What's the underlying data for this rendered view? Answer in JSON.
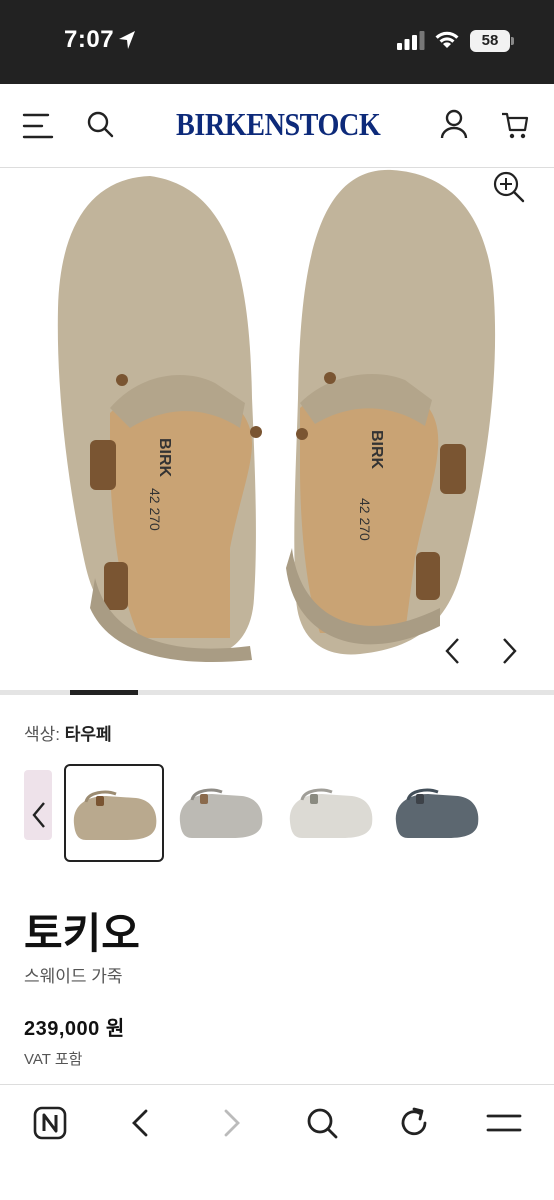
{
  "status_bar": {
    "time": "7:07",
    "battery": "58"
  },
  "header": {
    "logo": "BIRKENSTOCK",
    "brand_color": "#0d2a7a"
  },
  "product": {
    "color_label": "색상:",
    "color_value": "타우페",
    "name": "토키오",
    "material": "스웨이드 가죽",
    "price": "239,000 원",
    "vat_note": "VAT 포함",
    "image_progress": 0.25,
    "swatches": [
      {
        "name": "taupe",
        "color": "#b9a98e",
        "selected": true
      },
      {
        "name": "stone",
        "color": "#bcbab4",
        "selected": false
      },
      {
        "name": "white",
        "color": "#dcdad4",
        "selected": false
      },
      {
        "name": "blue-grey",
        "color": "#5c6770",
        "selected": false
      }
    ]
  },
  "icons": {
    "header": [
      "menu-icon",
      "search-icon",
      "account-icon",
      "cart-icon"
    ],
    "image": [
      "zoom-icon",
      "prev-image-icon",
      "next-image-icon"
    ],
    "bottom_bar": [
      "naver-home-icon",
      "back-icon",
      "forward-icon",
      "search-icon",
      "reload-icon",
      "menu-icon"
    ]
  }
}
